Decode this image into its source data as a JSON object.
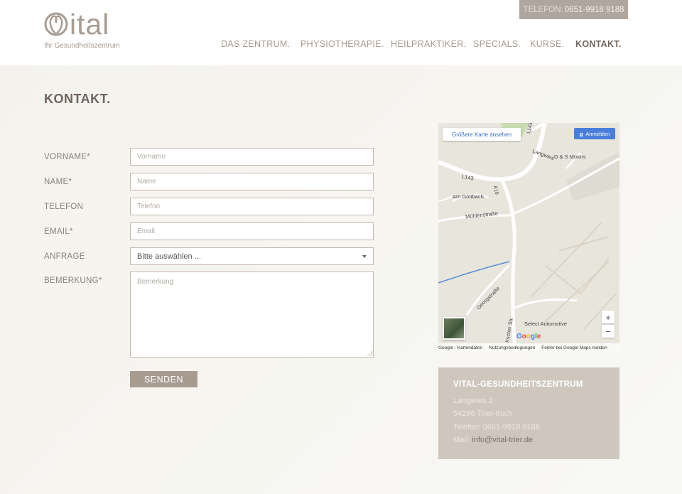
{
  "header": {
    "logo_text": "Vital",
    "logo_tagline": "Ihr Gesundheitszentrum",
    "phone_label": "TELEFON:",
    "phone_number": "0651-9918 9188",
    "nav": [
      {
        "label": "DAS ZENTRUM."
      },
      {
        "label": "PHYSIOTHERAPIE."
      },
      {
        "label": "HEILPRAKTIKER."
      },
      {
        "label": "SPECIALS."
      },
      {
        "label": "KURSE."
      },
      {
        "label": "KONTAKT."
      }
    ],
    "active_nav": "KONTAKT."
  },
  "page": {
    "title": "KONTAKT."
  },
  "form": {
    "fields": [
      {
        "label": "VORNAME*",
        "placeholder": "Vorname"
      },
      {
        "label": "NAME*",
        "placeholder": "Name"
      },
      {
        "label": "TELEFON",
        "placeholder": "Telefon"
      },
      {
        "label": "EMAIL*",
        "placeholder": "Email"
      }
    ],
    "select": {
      "label": "ANFRAGE",
      "value": "Bitte auswählen ..."
    },
    "textarea": {
      "label": "BEMERKUNG*",
      "placeholder": "Bemerkung"
    },
    "submit_label": "SENDEN"
  },
  "map": {
    "larger_map_label": "Größere Karte ansehen",
    "signin_label": "Anmelden",
    "labels": {
      "l143_top": "L143",
      "l143": "L143",
      "langwies": "Langwies",
      "ds_motors": "D & S Motors",
      "am_gottbach": "Am Gottbach",
      "muehlenstrasse": "Mühlenstraße",
      "k10": "K10",
      "georgstrasse": "Georgstraße",
      "irscher_str": "Irscher Str.",
      "select_automotive": "Select Automotive"
    },
    "zoom_in": "+",
    "zoom_out": "−",
    "google": "Google",
    "footer": [
      "Google - Kartendaten",
      "Nutzungsbedingungen",
      "Fehler bei Google Maps melden"
    ],
    "colors": {
      "road": "#ffffff",
      "land": "#e8e5dc",
      "water": "#5b8ed6",
      "park": "#c8dcb0"
    }
  },
  "address": {
    "title": "VITAL-GESUNDHEITSZENTRUM",
    "street": "Langwies 2",
    "city": "54296 Trier-Irsch",
    "phone": "Telefon: 0651-9918 9188",
    "mail_label": "Mail:",
    "mail": "info@vital-trier.de"
  },
  "colors": {
    "brand": "#a89b90",
    "nav_active": "#6f655d",
    "address_bg": "#cfc7be"
  }
}
